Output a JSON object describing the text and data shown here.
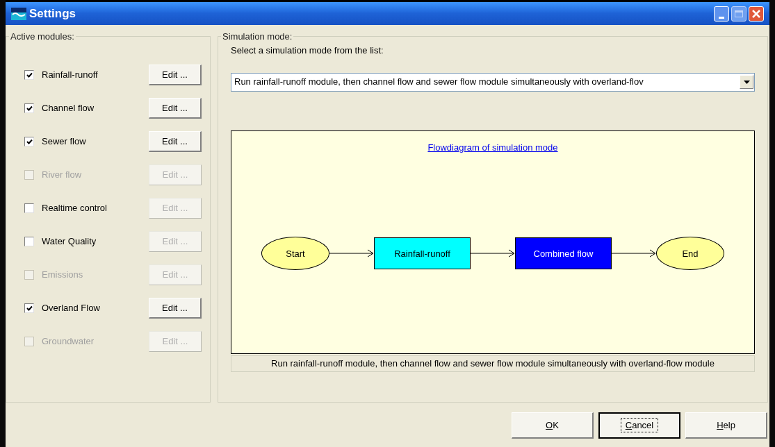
{
  "window": {
    "title": "Settings"
  },
  "modules_group": {
    "title": "Active modules:",
    "modules": [
      {
        "label": "Rainfall-runoff",
        "checked": true,
        "disabled": false,
        "edit": {
          "label": "Edit ...",
          "disabled": false
        }
      },
      {
        "label": "Channel flow",
        "checked": true,
        "disabled": false,
        "edit": {
          "label": "Edit ...",
          "disabled": false
        }
      },
      {
        "label": "Sewer flow",
        "checked": true,
        "disabled": false,
        "edit": {
          "label": "Edit ...",
          "disabled": false
        }
      },
      {
        "label": "River flow",
        "checked": false,
        "disabled": true,
        "edit": {
          "label": "Edit ...",
          "disabled": true
        }
      },
      {
        "label": "Realtime control",
        "checked": false,
        "disabled": false,
        "edit": {
          "label": "Edit ...",
          "disabled": true
        }
      },
      {
        "label": "Water Quality",
        "checked": false,
        "disabled": false,
        "edit": {
          "label": "Edit ...",
          "disabled": true
        }
      },
      {
        "label": "Emissions",
        "checked": false,
        "disabled": true,
        "edit": {
          "label": "Edit ...",
          "disabled": true
        }
      },
      {
        "label": "Overland Flow",
        "checked": true,
        "disabled": false,
        "edit": {
          "label": "Edit ...",
          "disabled": false
        }
      },
      {
        "label": "Groundwater",
        "checked": false,
        "disabled": true,
        "edit": {
          "label": "Edit ...",
          "disabled": true
        }
      }
    ]
  },
  "simulation_group": {
    "title": "Simulation mode:",
    "prompt": "Select a simulation mode from the list:",
    "mode_select": {
      "value": "Run rainfall-runoff module, then channel flow and sewer flow module simultaneously with overland-flov"
    },
    "diagram": {
      "link": "Flowdiagram of simulation mode",
      "nodes": [
        {
          "kind": "ellipse",
          "label": "Start",
          "color": "#ffff99"
        },
        {
          "kind": "box",
          "label": "Rainfall-runoff",
          "color": "#00ffff"
        },
        {
          "kind": "box",
          "label": "Combined flow",
          "color": "#0000ff"
        },
        {
          "kind": "ellipse",
          "label": "End",
          "color": "#ffff99"
        }
      ]
    },
    "description": "Run rainfall-runoff module, then channel flow and sewer flow module simultaneously with overland-flow module"
  },
  "buttons": [
    {
      "label": "OK",
      "underline_first": true,
      "focused": false
    },
    {
      "label": "Cancel",
      "underline_first": true,
      "focused": true
    },
    {
      "label": "Help",
      "underline_first": true,
      "focused": false
    }
  ]
}
